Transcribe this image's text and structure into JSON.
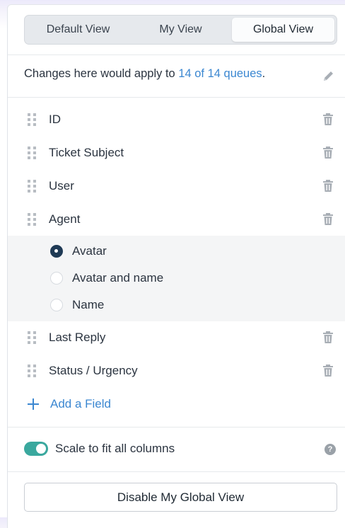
{
  "view_tabs": [
    {
      "label": "Default View",
      "active": false
    },
    {
      "label": "My View",
      "active": false
    },
    {
      "label": "Global View",
      "active": true
    }
  ],
  "notice": {
    "prefix": "Changes here would apply to ",
    "link": "14 of 14 queues",
    "suffix": "."
  },
  "fields": [
    {
      "label": "ID"
    },
    {
      "label": "Ticket Subject"
    },
    {
      "label": "User"
    },
    {
      "label": "Agent"
    }
  ],
  "agent_display_options": [
    {
      "label": "Avatar",
      "checked": true
    },
    {
      "label": "Avatar and name",
      "checked": false
    },
    {
      "label": "Name",
      "checked": false
    }
  ],
  "fields_after": [
    {
      "label": "Last Reply"
    },
    {
      "label": "Status / Urgency"
    }
  ],
  "add_field_label": "Add a Field",
  "scale_toggle": {
    "label": "Scale to fit all columns",
    "on": true
  },
  "help_glyph": "?",
  "disable_button_label": "Disable My Global View",
  "colors": {
    "accent_link": "#3b87d1",
    "toggle_on": "#3aa89e",
    "radio_checked": "#1f3a55"
  }
}
